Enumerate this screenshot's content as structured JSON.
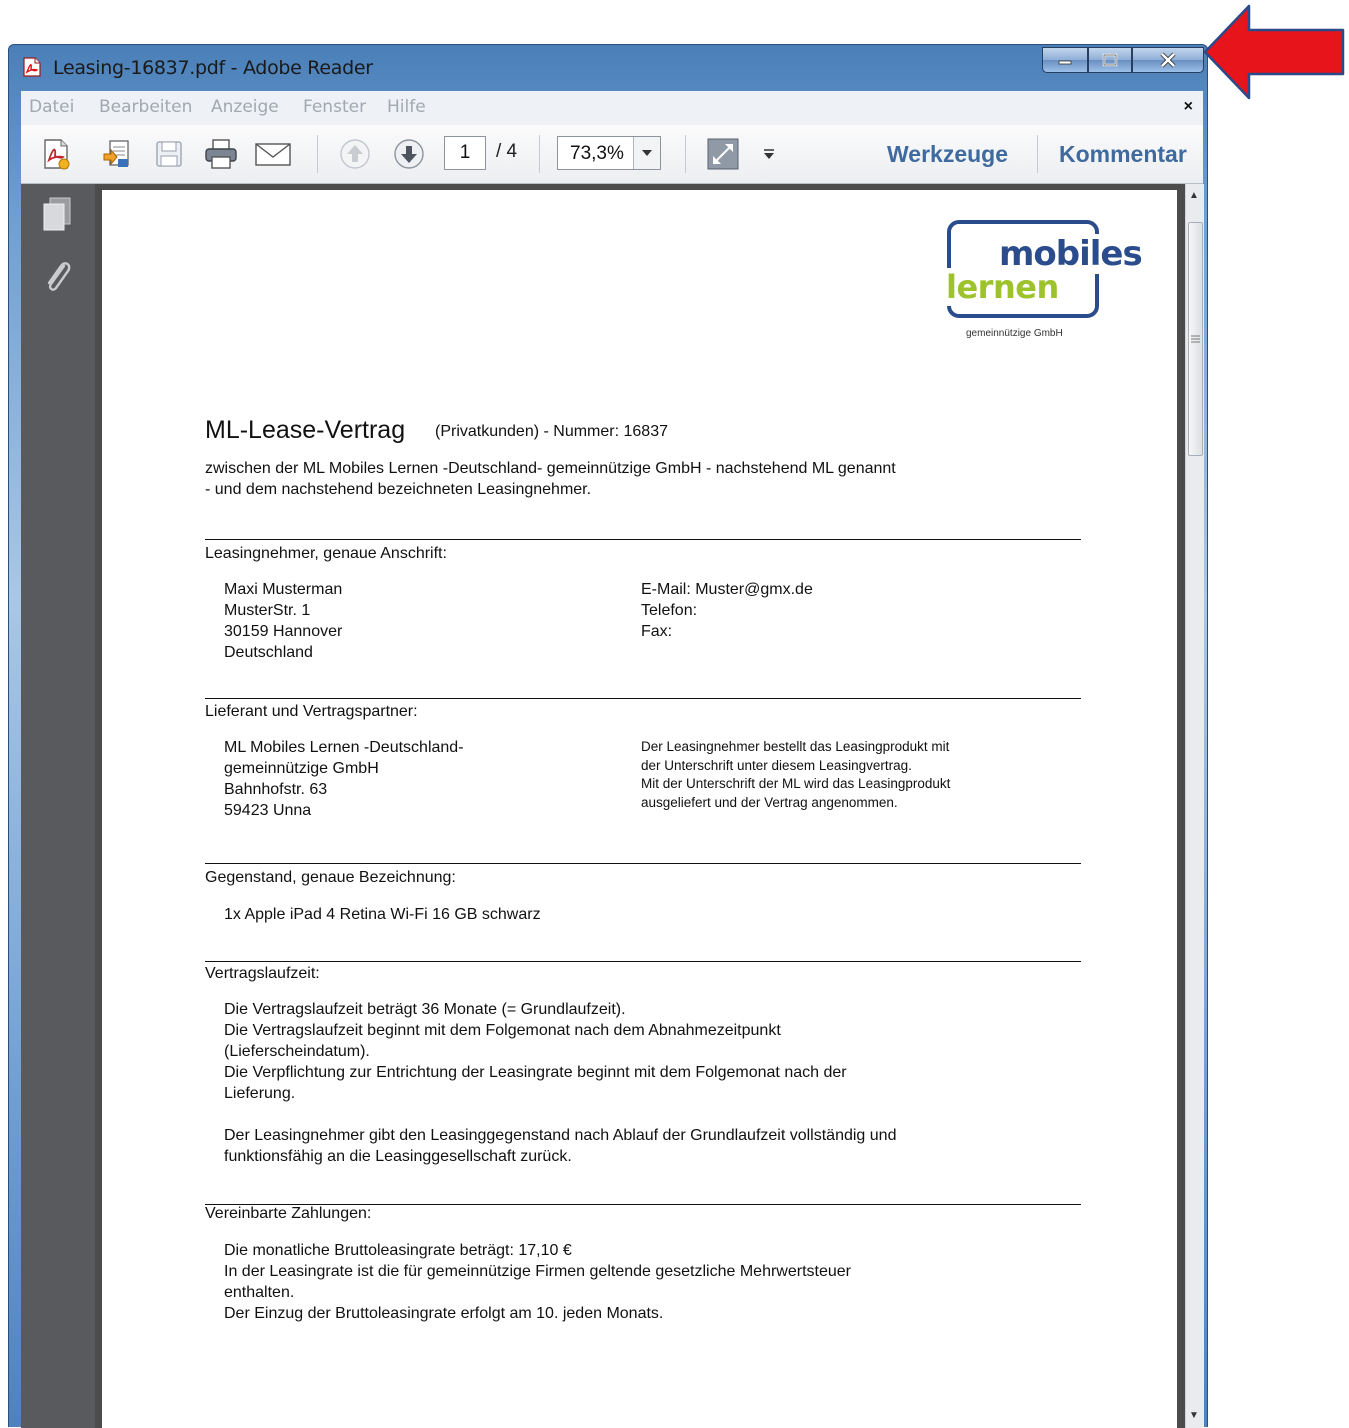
{
  "window": {
    "title": "Leasing-16837.pdf - Adobe Reader"
  },
  "menu": {
    "items": [
      "Datei",
      "Bearbeiten",
      "Anzeige",
      "Fenster",
      "Hilfe"
    ],
    "close_glyph": "×"
  },
  "toolbar": {
    "icons": [
      "create-pdf-icon",
      "export-pdf-icon",
      "save-icon",
      "print-icon",
      "email-icon",
      "page-up-icon",
      "page-down-icon"
    ],
    "page_current": "1",
    "page_total": "/ 4",
    "zoom": "73,3%",
    "tools_label": "Werkzeuge",
    "comment_label": "Kommentar"
  },
  "document": {
    "logo": {
      "line1": "mobiles",
      "line2": "lernen",
      "sub": "gemeinnützige GmbH",
      "colors": {
        "blue": "#2a4c8c",
        "green": "#9cc22c"
      }
    },
    "heading": "ML-Lease-Vertrag",
    "heading_sub": "(Privatkunden) - Nummer: 16837",
    "intro": [
      "zwischen der ML Mobiles Lernen -Deutschland- gemeinnützige GmbH - nachstehend ML genannt",
      "- und dem nachstehend bezeichneten Leasingnehmer."
    ],
    "lessee": {
      "title": "Leasingnehmer, genaue Anschrift:",
      "address": [
        "Maxi Musterman",
        "MusterStr. 1",
        "30159 Hannover",
        "Deutschland"
      ],
      "contact": [
        "E-Mail: Muster@gmx.de",
        "Telefon:",
        "Fax:"
      ]
    },
    "supplier": {
      "title": "Lieferant und Vertragspartner:",
      "address": [
        "ML Mobiles Lernen -Deutschland-",
        "gemeinnützige GmbH",
        "Bahnhofstr. 63",
        "59423 Unna"
      ],
      "note": [
        "Der Leasingnehmer bestellt das Leasingprodukt mit",
        "der Unterschrift unter diesem Leasingvertrag.",
        "Mit der Unterschrift der ML wird das Leasingprodukt",
        "ausgeliefert und der Vertrag angenommen."
      ]
    },
    "item": {
      "title": "Gegenstand, genaue Bezeichnung:",
      "text": "1x Apple iPad 4 Retina Wi-Fi 16 GB schwarz"
    },
    "term": {
      "title": "Vertragslaufzeit:",
      "lines": [
        "Die Vertragslaufzeit beträgt 36 Monate (= Grundlaufzeit).",
        "Die Vertragslaufzeit beginnt mit dem Folgemonat nach dem Abnahmezeitpunkt",
        "(Lieferscheindatum).",
        "Die Verpflichtung zur Entrichtung der Leasingrate beginnt mit dem Folgemonat nach der",
        "Lieferung."
      ],
      "return_lines": [
        "Der Leasingnehmer gibt den Leasinggegenstand nach Ablauf der Grundlaufzeit vollständig und",
        "funktionsfähig an die Leasinggesellschaft zurück."
      ]
    },
    "payments": {
      "title": "Vereinbarte Zahlungen:",
      "lines": [
        "Die monatliche Bruttoleasingrate beträgt: 17,10 €",
        "In der Leasingrate ist die für gemeinnützige Firmen geltende gesetzliche Mehrwertsteuer",
        "enthalten.",
        "Der Einzug der Bruttoleasingrate erfolgt am 10. jeden Monats."
      ]
    }
  },
  "annotation": {
    "arrow_color": "#e8141b",
    "arrow_target": "close-button"
  }
}
